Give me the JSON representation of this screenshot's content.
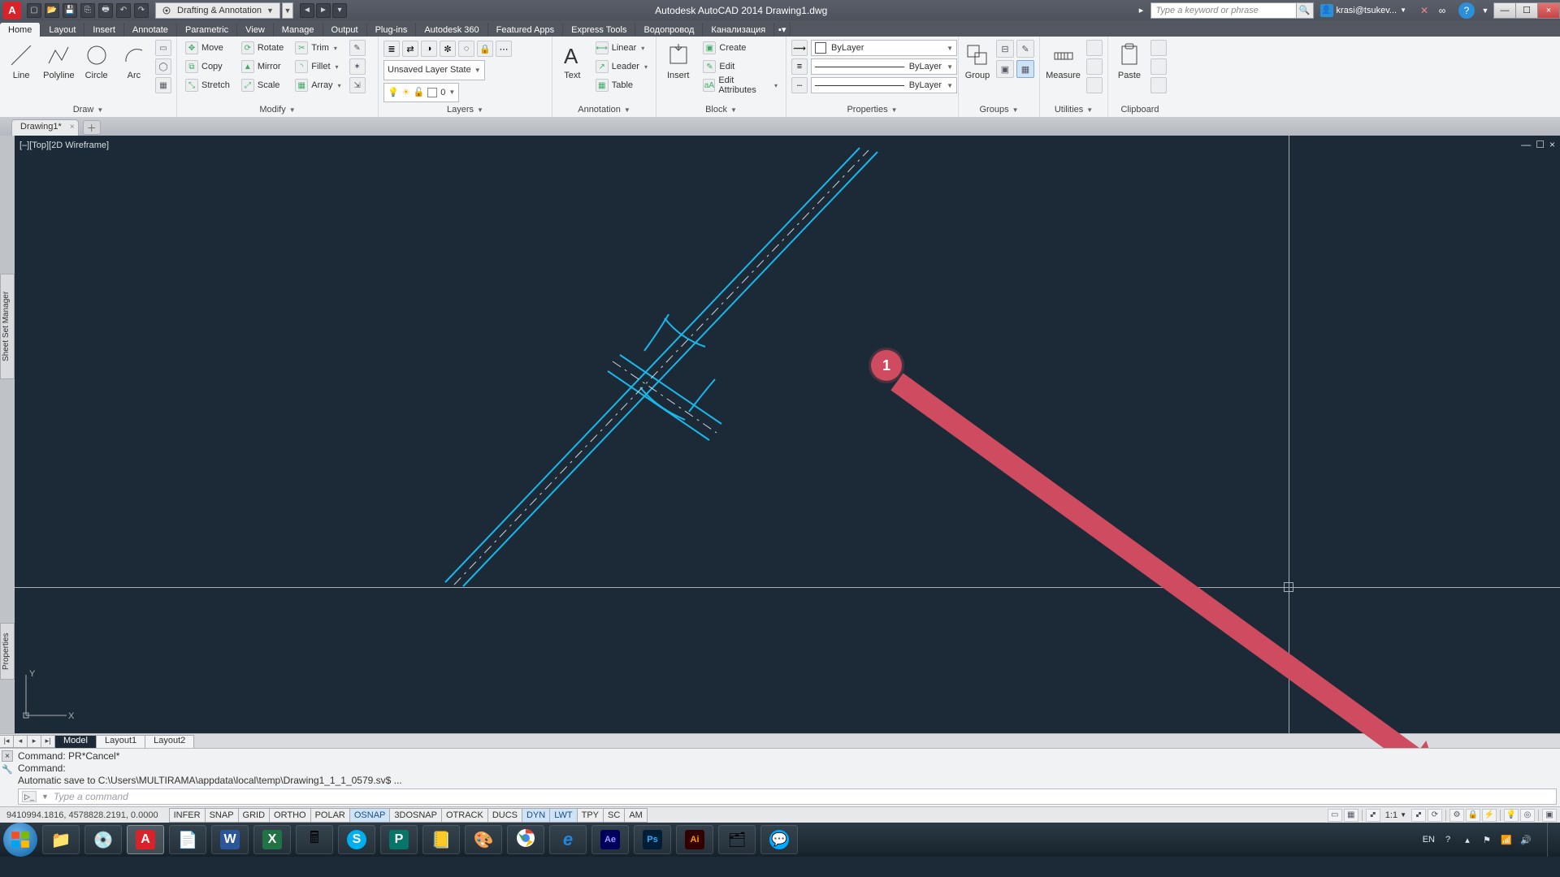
{
  "app": {
    "titlebar_text": "Autodesk AutoCAD 2014    Drawing1.dwg",
    "workspace_label": "Drafting & Annotation",
    "search_placeholder": "Type a keyword or phrase",
    "signin_user": "krasi@tsukev...",
    "win_min": "—",
    "win_max": "☐",
    "win_close": "×"
  },
  "menu": {
    "tabs": [
      "Home",
      "Layout",
      "Insert",
      "Annotate",
      "Parametric",
      "View",
      "Manage",
      "Output",
      "Plug-ins",
      "Autodesk 360",
      "Featured Apps",
      "Express Tools",
      "Водопровод",
      "Канализация"
    ],
    "active": "Home"
  },
  "ribbon": {
    "draw": {
      "label": "Draw",
      "big": [
        {
          "n": "Line"
        },
        {
          "n": "Polyline"
        },
        {
          "n": "Circle"
        },
        {
          "n": "Arc"
        }
      ]
    },
    "modify": {
      "label": "Modify",
      "rows": [
        [
          "Move",
          "Rotate",
          "Trim"
        ],
        [
          "Copy",
          "Mirror",
          "Fillet"
        ],
        [
          "Stretch",
          "Scale",
          "Array"
        ]
      ]
    },
    "layers": {
      "label": "Layers",
      "state_combo": "Unsaved Layer State",
      "current_combo": "0"
    },
    "annotation": {
      "label": "Annotation",
      "text": "Text",
      "rows": [
        "Linear",
        "Leader",
        "Table"
      ]
    },
    "block": {
      "label": "Block",
      "insert": "Insert",
      "rows": [
        "Create",
        "Edit",
        "Edit Attributes"
      ]
    },
    "properties": {
      "label": "Properties",
      "bylayer": "ByLayer"
    },
    "groups": {
      "label": "Groups",
      "group": "Group"
    },
    "utilities": {
      "label": "Utilities",
      "measure": "Measure"
    },
    "clipboard": {
      "label": "Clipboard",
      "paste": "Paste"
    }
  },
  "doc_tabs": {
    "active": "Drawing1*"
  },
  "viewport": {
    "label": "[–][Top][2D Wireframe]"
  },
  "annotation_callout": {
    "number": "1"
  },
  "layout_tabs": {
    "tabs": [
      "Model",
      "Layout1",
      "Layout2"
    ],
    "active": "Model"
  },
  "command": {
    "hist1": "Command: PR*Cancel*",
    "hist2": "Command:",
    "hist3": "Automatic save to C:\\Users\\MULTIRAMA\\appdata\\local\\temp\\Drawing1_1_1_0579.sv$ ...",
    "hist4": "Command:",
    "placeholder": "Type a command"
  },
  "status": {
    "coords": "9410994.1816, 4578828.2191, 0.0000",
    "toggles": [
      {
        "t": "INFER",
        "on": false
      },
      {
        "t": "SNAP",
        "on": false
      },
      {
        "t": "GRID",
        "on": false
      },
      {
        "t": "ORTHO",
        "on": false
      },
      {
        "t": "POLAR",
        "on": false
      },
      {
        "t": "OSNAP",
        "on": true
      },
      {
        "t": "3DOSNAP",
        "on": false
      },
      {
        "t": "OTRACK",
        "on": false
      },
      {
        "t": "DUCS",
        "on": false
      },
      {
        "t": "DYN",
        "on": true
      },
      {
        "t": "LWT",
        "on": true
      },
      {
        "t": "TPY",
        "on": false
      },
      {
        "t": "SC",
        "on": false
      },
      {
        "t": "AM",
        "on": false
      }
    ],
    "scale": "1:1"
  },
  "taskbar": {
    "lang": "EN",
    "time": "",
    "date": ""
  }
}
